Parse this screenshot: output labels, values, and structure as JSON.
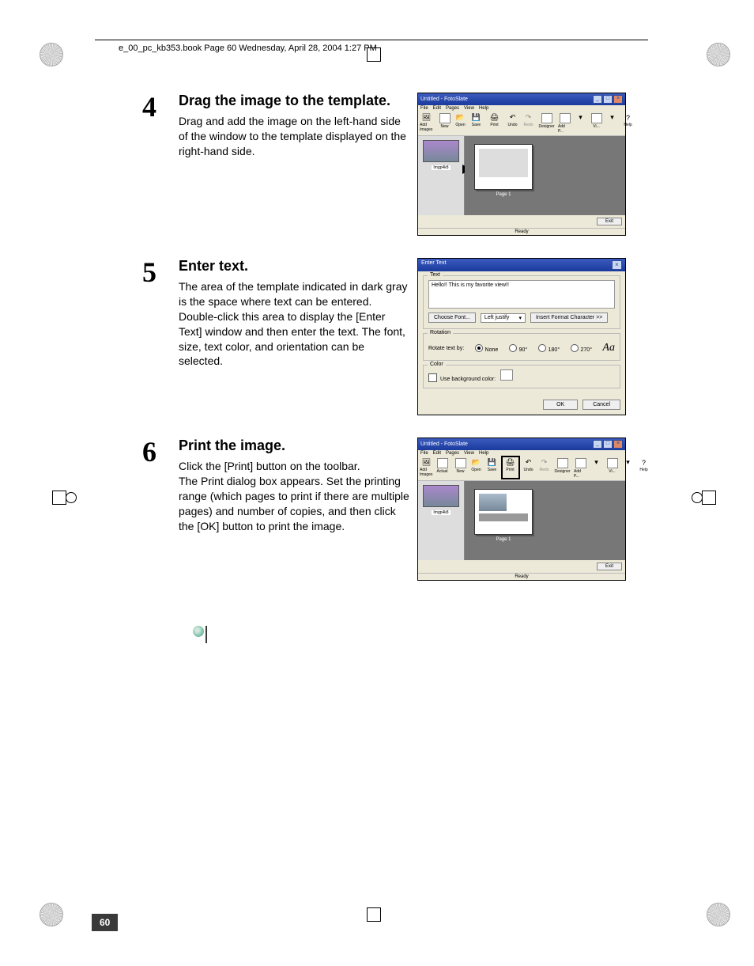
{
  "header_line": "e_00_pc_kb353.book  Page 60  Wednesday, April 28, 2004  1:27 PM",
  "page_number": "60",
  "steps": [
    {
      "num": "4",
      "title": "Drag the image to the template.",
      "body": "Drag and add the image on the left-hand side of the window to the template displayed on the right-hand side."
    },
    {
      "num": "5",
      "title": "Enter text.",
      "body": "The area of the template indicated in dark gray is the space where text can be entered. Double-click this area to display the [Enter Text] window and then enter the text. The font, size, text color, and orientation can be selected."
    },
    {
      "num": "6",
      "title": "Print the image.",
      "body": "Click the [Print] button on the toolbar.\nThe Print dialog box appears. Set the printing range (which pages to print if there are multiple pages) and number of copies, and then click the [OK] button to print the image."
    }
  ],
  "app": {
    "title": "Untitled - FotoSlate",
    "menus": [
      "File",
      "Edit",
      "Pages",
      "View",
      "Help"
    ],
    "buttons": {
      "add_images": "Add Images",
      "actual": "Actual",
      "new": "New",
      "open": "Open",
      "save": "Save",
      "print": "Print",
      "undo": "Undo",
      "redo": "Redo",
      "designer": "Designer",
      "add_p": "Add P...",
      "vi": "Vi...",
      "help": "Help"
    },
    "thumb_label": "Imgp4k8",
    "page_label": "Page 1",
    "exit": "Exit",
    "status": "Ready"
  },
  "dialog": {
    "title": "Enter Text",
    "text_group": "Text",
    "sample": "Hello!! This is my favorite view!!",
    "choose_font": "Choose Font...",
    "justify": "Left justify",
    "insert_char": "Insert Format Character >>",
    "rot_group": "Rotation",
    "rotate_by": "Rotate text by:",
    "r_none": "None",
    "r_90": "90°",
    "r_180": "180°",
    "r_270": "270°",
    "aa": "Aa",
    "color_group": "Color",
    "use_bg": "Use background color:",
    "ok": "OK",
    "cancel": "Cancel"
  }
}
